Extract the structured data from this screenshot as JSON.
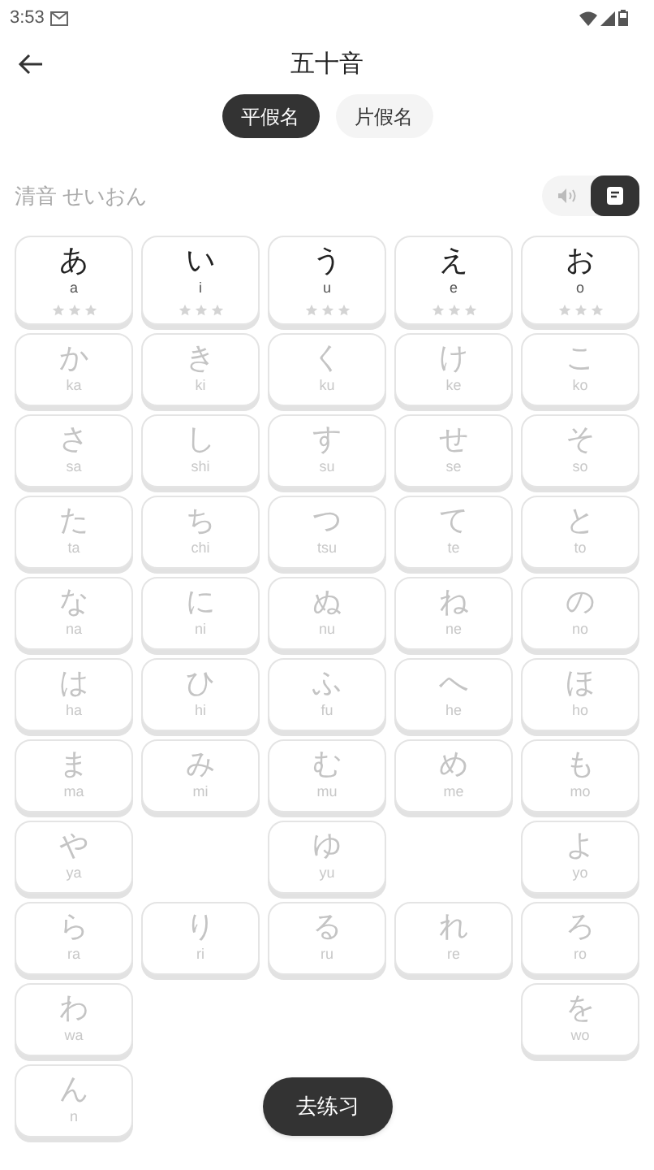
{
  "status_bar": {
    "time": "3:53"
  },
  "header": {
    "title": "五十音"
  },
  "tabs": [
    {
      "label": "平假名",
      "selected": true
    },
    {
      "label": "片假名",
      "selected": false
    }
  ],
  "section": {
    "title": "清音",
    "reading": "せいおん",
    "modes": [
      {
        "kind": "audio",
        "selected": false
      },
      {
        "kind": "card",
        "selected": true
      }
    ]
  },
  "rows": [
    {
      "cells": [
        {
          "kind": "kana",
          "kana": "あ",
          "romaji": "a",
          "disabled": false,
          "stars": 0
        },
        {
          "kind": "kana",
          "kana": "い",
          "romaji": "i",
          "disabled": false,
          "stars": 0
        },
        {
          "kind": "kana",
          "kana": "う",
          "romaji": "u",
          "disabled": false,
          "stars": 0
        },
        {
          "kind": "kana",
          "kana": "え",
          "romaji": "e",
          "disabled": false,
          "stars": 0
        },
        {
          "kind": "kana",
          "kana": "お",
          "romaji": "o",
          "disabled": false,
          "stars": 0
        }
      ]
    },
    {
      "cells": [
        {
          "kind": "kana",
          "kana": "か",
          "romaji": "ka",
          "disabled": true
        },
        {
          "kind": "kana",
          "kana": "き",
          "romaji": "ki",
          "disabled": true
        },
        {
          "kind": "kana",
          "kana": "く",
          "romaji": "ku",
          "disabled": true
        },
        {
          "kind": "kana",
          "kana": "け",
          "romaji": "ke",
          "disabled": true
        },
        {
          "kind": "kana",
          "kana": "こ",
          "romaji": "ko",
          "disabled": true
        }
      ]
    },
    {
      "cells": [
        {
          "kind": "kana",
          "kana": "さ",
          "romaji": "sa",
          "disabled": true
        },
        {
          "kind": "kana",
          "kana": "し",
          "romaji": "shi",
          "disabled": true
        },
        {
          "kind": "kana",
          "kana": "す",
          "romaji": "su",
          "disabled": true
        },
        {
          "kind": "kana",
          "kana": "せ",
          "romaji": "se",
          "disabled": true
        },
        {
          "kind": "kana",
          "kana": "そ",
          "romaji": "so",
          "disabled": true
        }
      ]
    },
    {
      "cells": [
        {
          "kind": "kana",
          "kana": "た",
          "romaji": "ta",
          "disabled": true
        },
        {
          "kind": "kana",
          "kana": "ち",
          "romaji": "chi",
          "disabled": true
        },
        {
          "kind": "kana",
          "kana": "つ",
          "romaji": "tsu",
          "disabled": true
        },
        {
          "kind": "kana",
          "kana": "て",
          "romaji": "te",
          "disabled": true
        },
        {
          "kind": "kana",
          "kana": "と",
          "romaji": "to",
          "disabled": true
        }
      ]
    },
    {
      "cells": [
        {
          "kind": "kana",
          "kana": "な",
          "romaji": "na",
          "disabled": true
        },
        {
          "kind": "kana",
          "kana": "に",
          "romaji": "ni",
          "disabled": true
        },
        {
          "kind": "kana",
          "kana": "ぬ",
          "romaji": "nu",
          "disabled": true
        },
        {
          "kind": "kana",
          "kana": "ね",
          "romaji": "ne",
          "disabled": true
        },
        {
          "kind": "kana",
          "kana": "の",
          "romaji": "no",
          "disabled": true
        }
      ]
    },
    {
      "cells": [
        {
          "kind": "kana",
          "kana": "は",
          "romaji": "ha",
          "disabled": true
        },
        {
          "kind": "kana",
          "kana": "ひ",
          "romaji": "hi",
          "disabled": true
        },
        {
          "kind": "kana",
          "kana": "ふ",
          "romaji": "fu",
          "disabled": true
        },
        {
          "kind": "kana",
          "kana": "へ",
          "romaji": "he",
          "disabled": true
        },
        {
          "kind": "kana",
          "kana": "ほ",
          "romaji": "ho",
          "disabled": true
        }
      ]
    },
    {
      "cells": [
        {
          "kind": "kana",
          "kana": "ま",
          "romaji": "ma",
          "disabled": true
        },
        {
          "kind": "kana",
          "kana": "み",
          "romaji": "mi",
          "disabled": true
        },
        {
          "kind": "kana",
          "kana": "む",
          "romaji": "mu",
          "disabled": true
        },
        {
          "kind": "kana",
          "kana": "め",
          "romaji": "me",
          "disabled": true
        },
        {
          "kind": "kana",
          "kana": "も",
          "romaji": "mo",
          "disabled": true
        }
      ]
    },
    {
      "cells": [
        {
          "kind": "kana",
          "kana": "や",
          "romaji": "ya",
          "disabled": true
        },
        {
          "kind": "blank"
        },
        {
          "kind": "kana",
          "kana": "ゆ",
          "romaji": "yu",
          "disabled": true
        },
        {
          "kind": "blank"
        },
        {
          "kind": "kana",
          "kana": "よ",
          "romaji": "yo",
          "disabled": true
        }
      ]
    },
    {
      "cells": [
        {
          "kind": "kana",
          "kana": "ら",
          "romaji": "ra",
          "disabled": true
        },
        {
          "kind": "kana",
          "kana": "り",
          "romaji": "ri",
          "disabled": true
        },
        {
          "kind": "kana",
          "kana": "る",
          "romaji": "ru",
          "disabled": true
        },
        {
          "kind": "kana",
          "kana": "れ",
          "romaji": "re",
          "disabled": true
        },
        {
          "kind": "kana",
          "kana": "ろ",
          "romaji": "ro",
          "disabled": true
        }
      ]
    },
    {
      "cells": [
        {
          "kind": "kana",
          "kana": "わ",
          "romaji": "wa",
          "disabled": true
        },
        {
          "kind": "blank"
        },
        {
          "kind": "blank"
        },
        {
          "kind": "blank"
        },
        {
          "kind": "kana",
          "kana": "を",
          "romaji": "wo",
          "disabled": true
        }
      ]
    },
    {
      "cells": [
        {
          "kind": "kana",
          "kana": "ん",
          "romaji": "n",
          "disabled": true
        },
        {
          "kind": "blank"
        },
        {
          "kind": "blank"
        },
        {
          "kind": "blank"
        },
        {
          "kind": "blank"
        }
      ]
    }
  ],
  "practice_button": {
    "label": "去练习"
  }
}
